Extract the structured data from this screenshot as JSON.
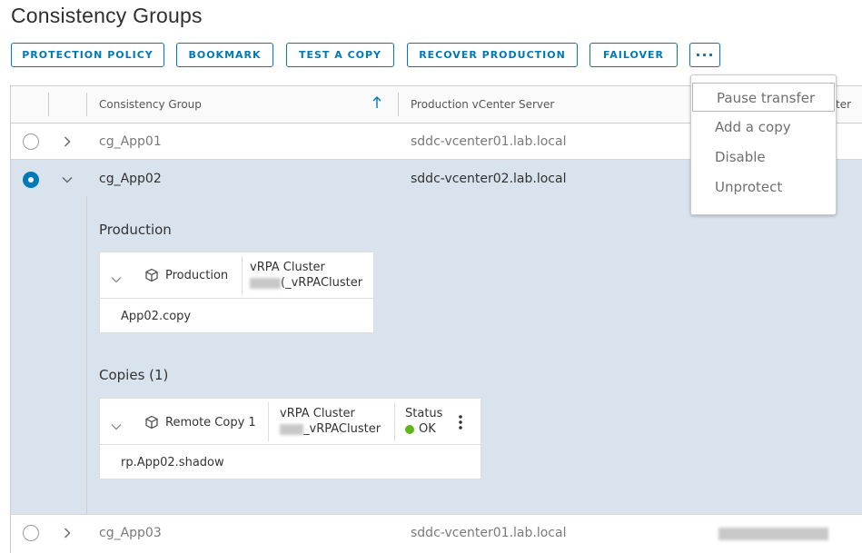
{
  "page": {
    "title": "Consistency Groups"
  },
  "toolbar": {
    "buttons": [
      {
        "label": "PROTECTION POLICY"
      },
      {
        "label": "BOOKMARK"
      },
      {
        "label": "TEST A COPY"
      },
      {
        "label": "RECOVER PRODUCTION"
      },
      {
        "label": "FAILOVER"
      }
    ],
    "more_label": "..."
  },
  "grid": {
    "columns": {
      "consistency_group": "Consistency Group",
      "production_vcenter": "Production vCenter Server",
      "clipped": "ter"
    },
    "rows": [
      {
        "name": "cg_App01",
        "vcenter": "sddc-vcenter01.lab.local",
        "selected": false
      },
      {
        "name": "cg_App02",
        "vcenter": "sddc-vcenter02.lab.local",
        "selected": true
      },
      {
        "name": "cg_App03",
        "vcenter": "sddc-vcenter01.lab.local",
        "selected": false
      }
    ]
  },
  "details": {
    "production_title": "Production",
    "production_card": {
      "label": "Production",
      "vrpa_label": "vRPA Cluster",
      "vrpa_value": "_vRPACluster",
      "vrpa_prefix": "(",
      "copy_name": "App02.copy"
    },
    "copies_title": "Copies (1)",
    "copy_card": {
      "label": "Remote Copy 1",
      "vrpa_label": "vRPA Cluster",
      "vrpa_value": "_vRPACluster",
      "status_label": "Status",
      "status_value": "OK",
      "copy_name": "rp.App02.shadow"
    }
  },
  "menu": {
    "items": [
      {
        "label": "Pause transfer"
      },
      {
        "label": "Add a copy"
      },
      {
        "label": "Disable"
      },
      {
        "label": "Unprotect"
      }
    ]
  },
  "colors": {
    "accent": "#0079b8",
    "selected_row": "#d9e3ee",
    "status_ok": "#5eb715"
  }
}
